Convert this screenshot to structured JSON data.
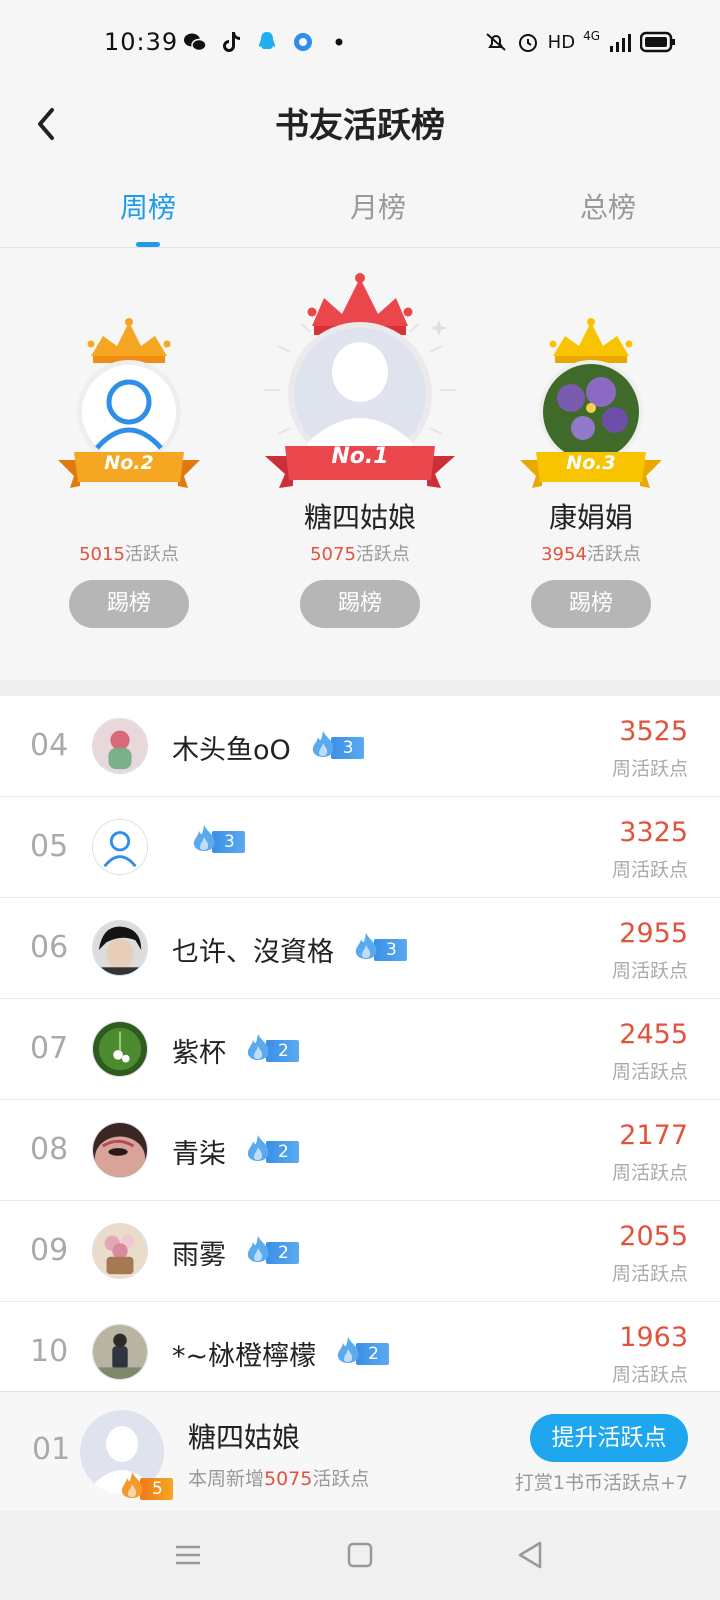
{
  "status_bar": {
    "time": "10:39",
    "hd_label": "HD",
    "network_label": "4G"
  },
  "header": {
    "title": "书友活跃榜"
  },
  "tabs": [
    {
      "label": "周榜",
      "active": true
    },
    {
      "label": "月榜",
      "active": false
    },
    {
      "label": "总榜",
      "active": false
    }
  ],
  "podium": {
    "first": {
      "badge": "No.1",
      "name": "糖四姑娘",
      "points": "5075",
      "points_suffix": "活跃点",
      "kick_label": "踢榜"
    },
    "second": {
      "badge": "No.2",
      "name": "",
      "points": "5015",
      "points_suffix": "活跃点",
      "kick_label": "踢榜"
    },
    "third": {
      "badge": "No.3",
      "name": "康娟娟",
      "points": "3954",
      "points_suffix": "活跃点",
      "kick_label": "踢榜"
    }
  },
  "rank_list": [
    {
      "rank": "04",
      "name": "木头鱼oO",
      "level": "3",
      "score": "3525",
      "score_label": "周活跃点"
    },
    {
      "rank": "05",
      "name": "",
      "level": "3",
      "score": "3325",
      "score_label": "周活跃点"
    },
    {
      "rank": "06",
      "name": "乜许、沒資格",
      "level": "3",
      "score": "2955",
      "score_label": "周活跃点"
    },
    {
      "rank": "07",
      "name": "紫杯",
      "level": "2",
      "score": "2455",
      "score_label": "周活跃点"
    },
    {
      "rank": "08",
      "name": "青柒",
      "level": "2",
      "score": "2177",
      "score_label": "周活跃点"
    },
    {
      "rank": "09",
      "name": "雨雾",
      "level": "2",
      "score": "2055",
      "score_label": "周活跃点"
    },
    {
      "rank": "10",
      "name": "*~栤橙檸檬",
      "level": "2",
      "score": "1963",
      "score_label": "周活跃点"
    }
  ],
  "my_rank": {
    "rank": "01",
    "name": "糖四姑娘",
    "level": "5",
    "sub_prefix": "本周新增",
    "sub_points": "5075",
    "sub_suffix": "活跃点",
    "boost_label": "提升活跃点",
    "tip": "打赏1书币活跃点+7"
  },
  "colors": {
    "accent": "#1e9bea",
    "score_red": "#e2533b",
    "gold": "#f5a623",
    "crown_red": "#e9474b",
    "crown_yellow": "#f8c400"
  }
}
